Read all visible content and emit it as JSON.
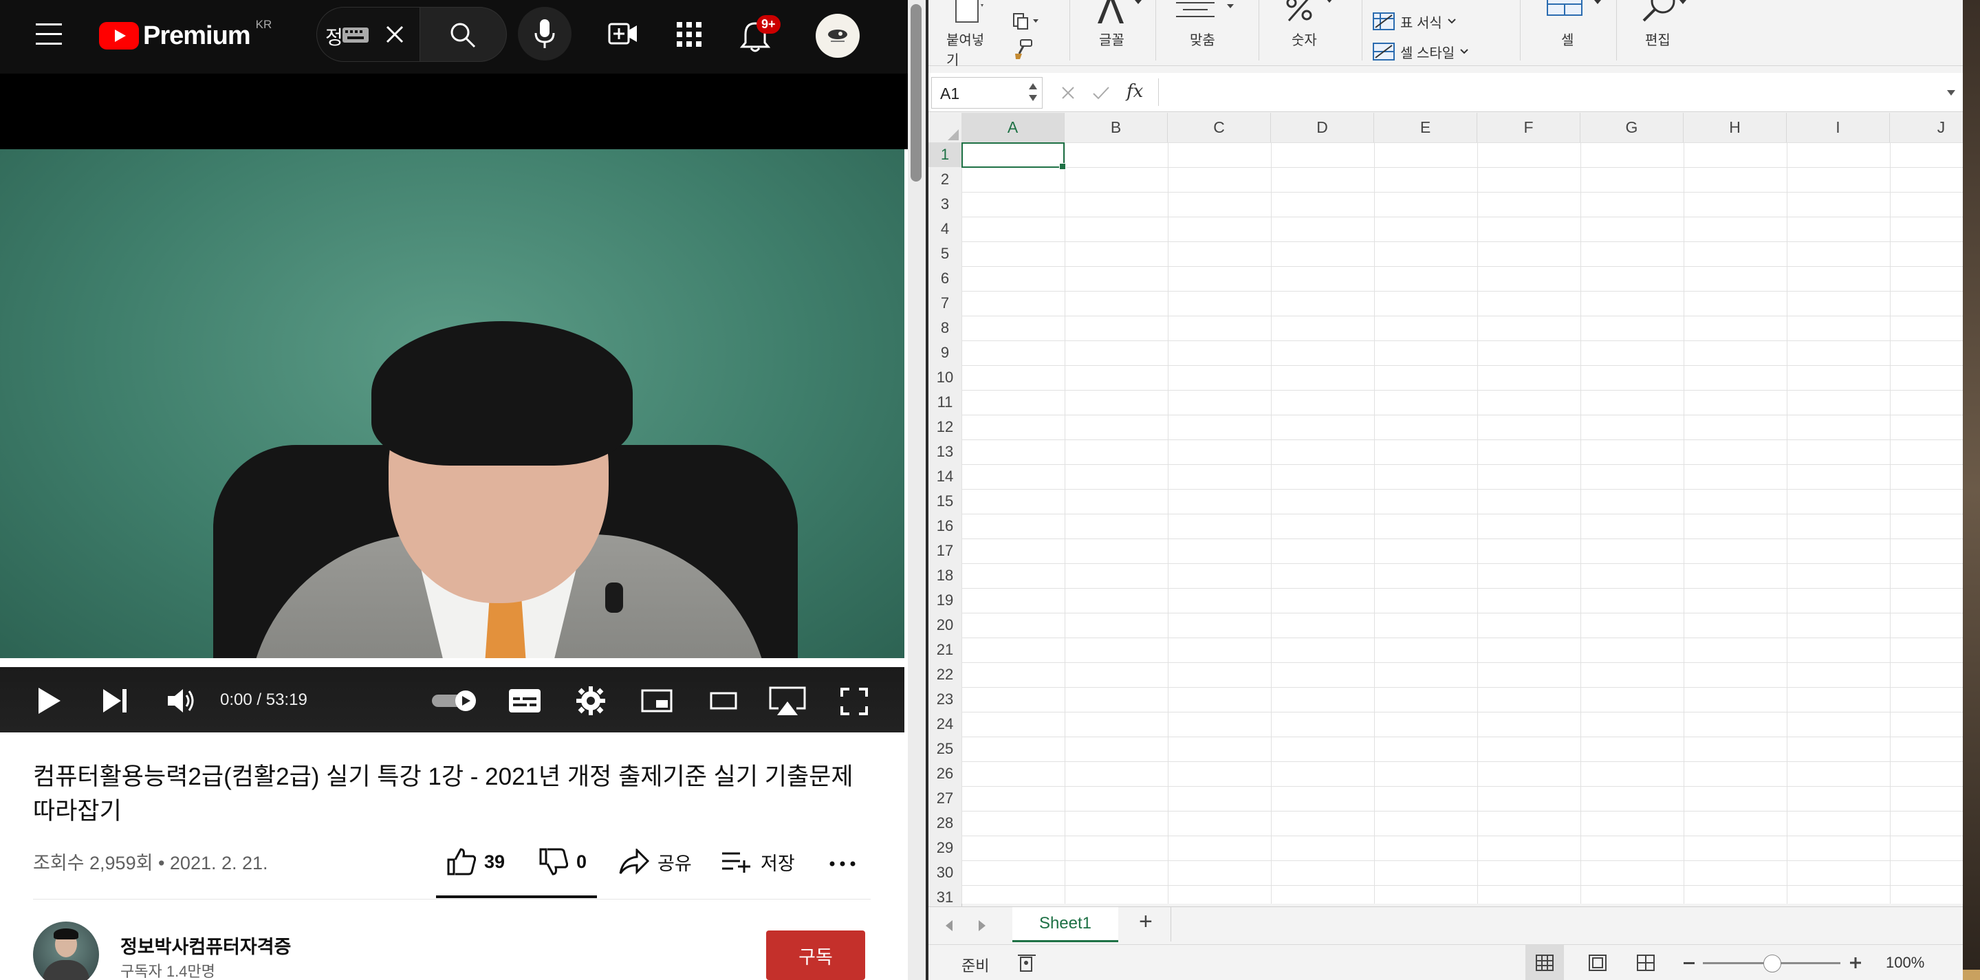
{
  "youtube": {
    "logo_text": "Premium",
    "region": "KR",
    "search_value": "정",
    "notifications_badge": "9+",
    "video": {
      "time_current": "0:00",
      "time_separator": " / ",
      "time_total": "53:19",
      "progress_fraction": 0.0
    },
    "title": "컴퓨터활용능력2급(컴활2급) 실기 특강 1강 - 2021년 개정 출제기준 실기 기출문제 따라잡기",
    "views": "조회수 2,959회",
    "meta_separator": " • ",
    "date": "2021. 2. 21.",
    "likes": "39",
    "dislikes": "0",
    "share_label": "공유",
    "save_label": "저장",
    "channel_name": "정보박사컴퓨터자격증",
    "subscribers": "구독자 1.4만명",
    "subscribe_label": "구독"
  },
  "excel": {
    "ribbon": {
      "paste_label": "붙여넣기",
      "font_label": "글꼴",
      "align_label": "맞춤",
      "number_label": "숫자",
      "table_format_label": "표 서식",
      "cell_style_label": "셀 스타일",
      "cell_label": "셀",
      "edit_label": "편집"
    },
    "name_box": "A1",
    "fx_label": "fx",
    "columns": [
      "A",
      "B",
      "C",
      "D",
      "E",
      "F",
      "G",
      "H",
      "I",
      "J"
    ],
    "rows": [
      "1",
      "2",
      "3",
      "4",
      "5",
      "6",
      "7",
      "8",
      "9",
      "10",
      "11",
      "12",
      "13",
      "14",
      "15",
      "16",
      "17",
      "18",
      "19",
      "20",
      "21",
      "22",
      "23",
      "24",
      "25",
      "26",
      "27",
      "28",
      "29",
      "30",
      "31"
    ],
    "sheet_tab": "Sheet1",
    "add_sheet": "+",
    "status_ready": "준비",
    "zoom": "100%",
    "zoom_fraction": 0.5
  }
}
